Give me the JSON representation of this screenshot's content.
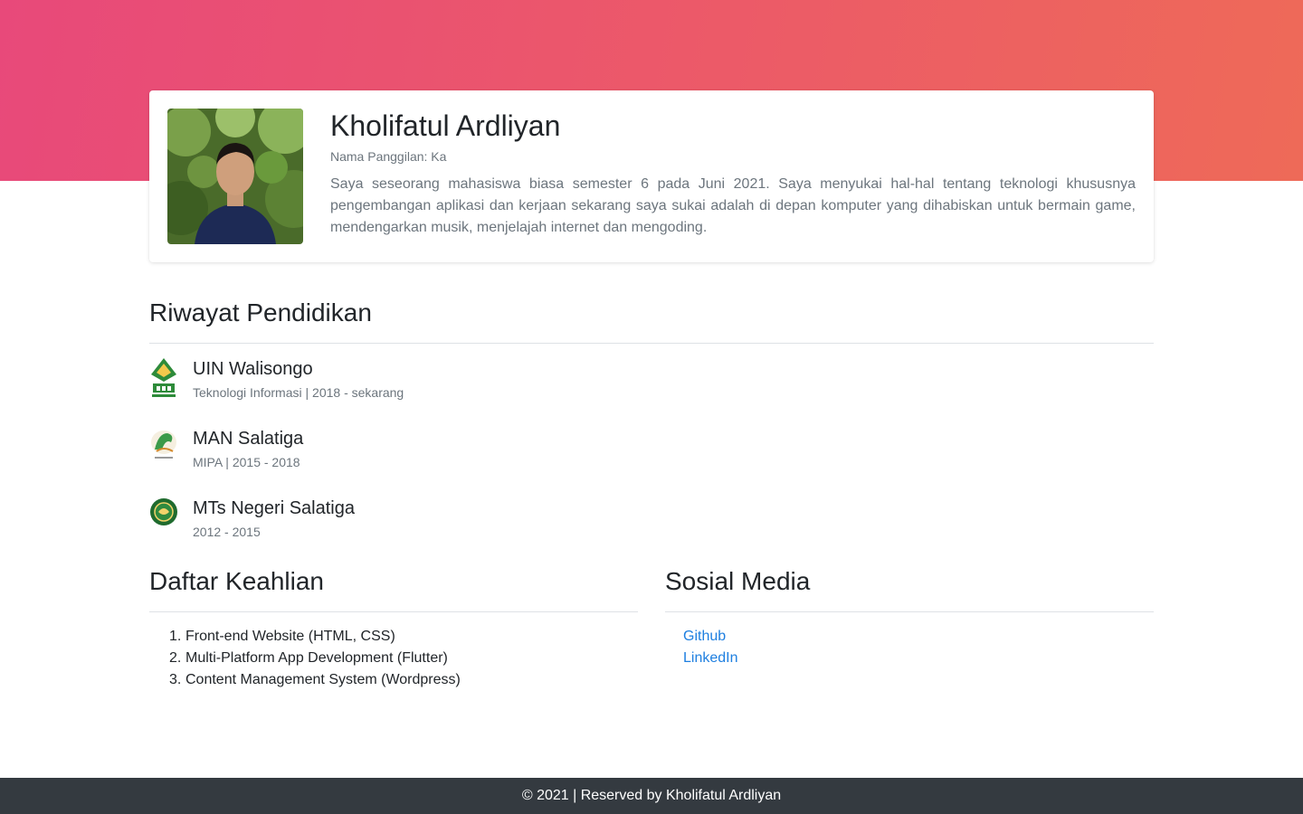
{
  "profile": {
    "name": "Kholifatul Ardliyan",
    "nickname_label": "Nama Panggilan:",
    "nickname": "Ka",
    "bio": "Saya seseorang mahasiswa biasa semester 6 pada Juni 2021. Saya menyukai hal-hal tentang teknologi khususnya pengembangan aplikasi dan kerjaan sekarang saya sukai adalah di depan komputer yang dihabiskan untuk bermain game, mendengarkan musik, menjelajah internet dan mengoding."
  },
  "education": {
    "title": "Riwayat Pendidikan",
    "items": [
      {
        "name": "UIN Walisongo",
        "detail": "Teknologi Informasi | 2018 - sekarang",
        "icon": "uin-walisongo-logo-icon"
      },
      {
        "name": "MAN Salatiga",
        "detail": "MIPA | 2015 - 2018",
        "icon": "man-salatiga-logo-icon"
      },
      {
        "name": "MTs Negeri Salatiga",
        "detail": "2012 - 2015",
        "icon": "mts-negeri-salatiga-logo-icon"
      }
    ]
  },
  "skills": {
    "title": "Daftar Keahlian",
    "items": [
      {
        "num": "1.",
        "label": "Front-end Website (HTML, CSS)"
      },
      {
        "num": "2.",
        "label": "Multi-Platform App Development (Flutter)"
      },
      {
        "num": "3.",
        "label": "Content Management System (Wordpress)"
      }
    ]
  },
  "social": {
    "title": "Sosial Media",
    "links": [
      {
        "label": "Github"
      },
      {
        "label": "LinkedIn"
      }
    ]
  },
  "footer": {
    "text": "© 2021 | Reserved by Kholifatul Ardliyan"
  },
  "colors": {
    "hero_gradient_start": "#e8497a",
    "hero_gradient_end": "#ee6a58",
    "link": "#1e7fe0",
    "footer_bg": "#343a40"
  }
}
